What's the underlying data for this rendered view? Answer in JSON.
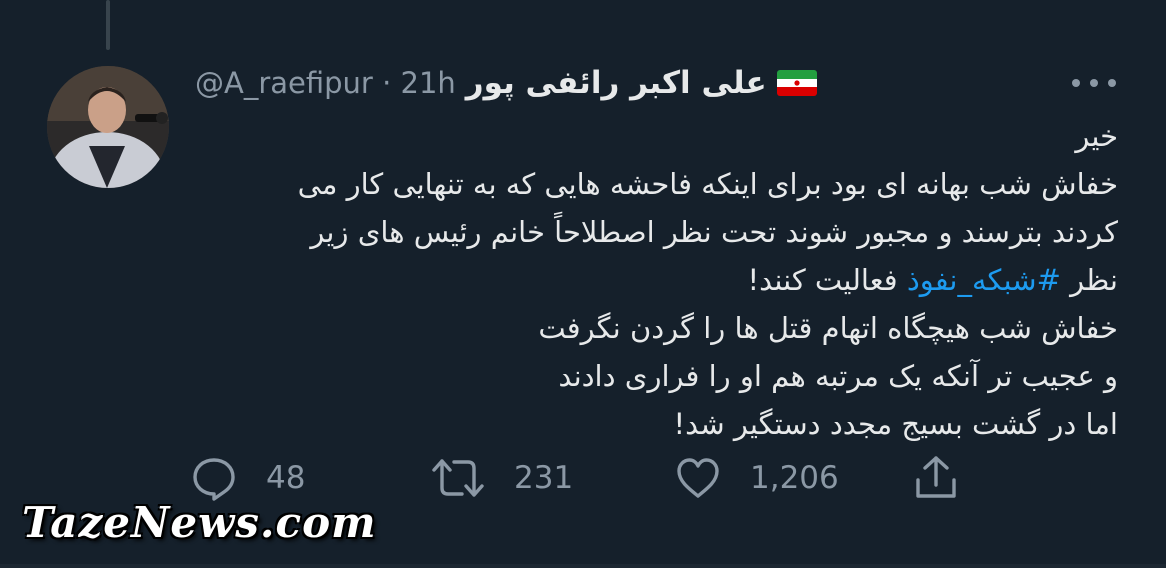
{
  "author": {
    "display_name": "علی اکبر رائفی پور",
    "handle": "@A_raefipur",
    "separator": "·",
    "time_ago": "21h",
    "flag_icon": "iran-flag-icon"
  },
  "tweet": {
    "lines": [
      {
        "text": "خیر"
      },
      {
        "text": "خفاش شب بهانه ای بود برای اینکه فاحشه هایی که به تنهایی کار می"
      },
      {
        "text": "کردند بترسند و مجبور شوند تحت نظر اصطلاحاً خانم رئیس های زیر"
      },
      {
        "pre": "نظر ",
        "hashtag": "#شبکه_نفوذ",
        "post": " فعالیت کنند!"
      },
      {
        "text": "خفاش شب هیچگاه اتهام قتل ها را گردن نگرفت"
      },
      {
        "text": "و عجیب تر آنکه  یک مرتبه هم او را فراری دادند"
      },
      {
        "text": "اما در گشت بسیج مجدد دستگیر شد!"
      }
    ]
  },
  "actions": {
    "reply": {
      "icon": "reply-icon",
      "count": "48"
    },
    "retweet": {
      "icon": "retweet-icon",
      "count": "231"
    },
    "like": {
      "icon": "heart-icon",
      "count": "1,206"
    },
    "share": {
      "icon": "share-icon"
    }
  },
  "watermark": "TazeNews.com",
  "colors": {
    "background": "#15202b",
    "text": "#e7e9ea",
    "muted": "#8b98a5",
    "hashtag": "#1d9bf0"
  }
}
